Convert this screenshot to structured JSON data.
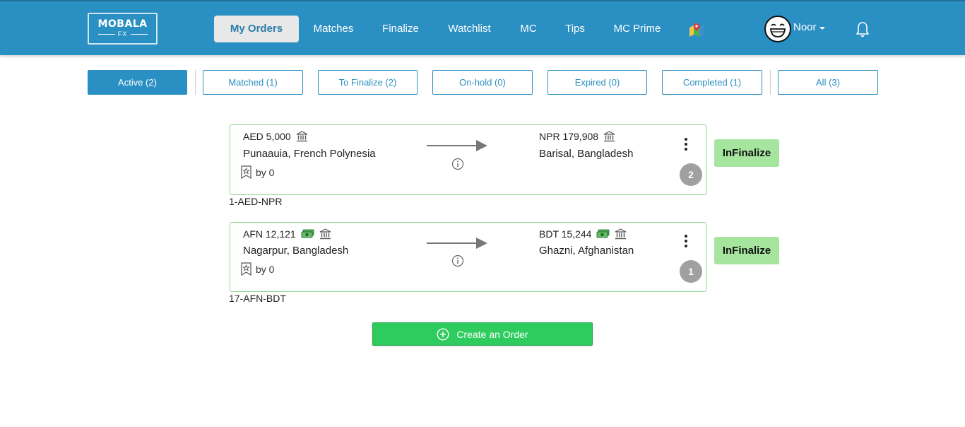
{
  "brand": {
    "name": "MOBALA",
    "sub": "FX"
  },
  "nav": {
    "items": [
      "My Orders",
      "Matches",
      "Finalize",
      "Watchlist",
      "MC",
      "Tips",
      "MC Prime"
    ],
    "active_index": 0
  },
  "user": {
    "name": "Noor"
  },
  "tabs": [
    "Active (2)",
    "Matched (1)",
    "To Finalize (2)",
    "On-hold (0)",
    "Expired (0)",
    "Completed (1)",
    "All (3)"
  ],
  "orders": [
    {
      "from_amount": "AED 5,000",
      "from_location": "Punaauia, French Polynesia",
      "to_amount": "NPR 179,908",
      "to_location": "Barisal, Bangladesh",
      "bookmark_text": "by 0",
      "count": "2",
      "status": "InFinalize",
      "id": "1-AED-NPR"
    },
    {
      "from_amount": "AFN 12,121",
      "from_location": "Nagarpur, Bangladesh",
      "to_amount": "BDT 15,244",
      "to_location": "Ghazni, Afghanistan",
      "bookmark_text": "by 0",
      "count": "1",
      "status": "InFinalize",
      "id": "17-AFN-BDT"
    }
  ],
  "create_button": {
    "label": "Create an Order"
  },
  "colors": {
    "primary": "#2a8fc2",
    "success": "#2ecc5e",
    "status_bg": "#a6e59e",
    "card_border": "#8cd68c"
  }
}
